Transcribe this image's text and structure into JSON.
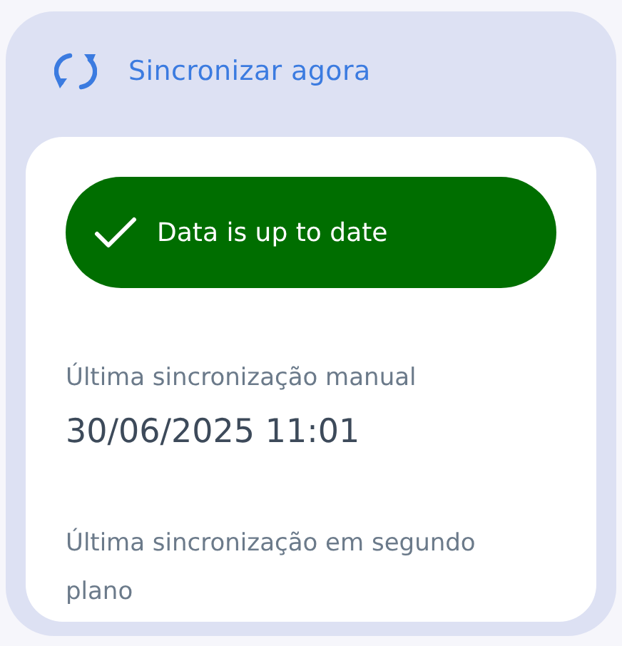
{
  "sync_action": {
    "label": "Sincronizar agora"
  },
  "status": {
    "kind": "success",
    "text": "Data is up to date"
  },
  "entries": [
    {
      "label": "Última sincronização manual",
      "value": "30/06/2025 11:01"
    },
    {
      "label": "Última sincronização em segundo plano"
    }
  ]
}
